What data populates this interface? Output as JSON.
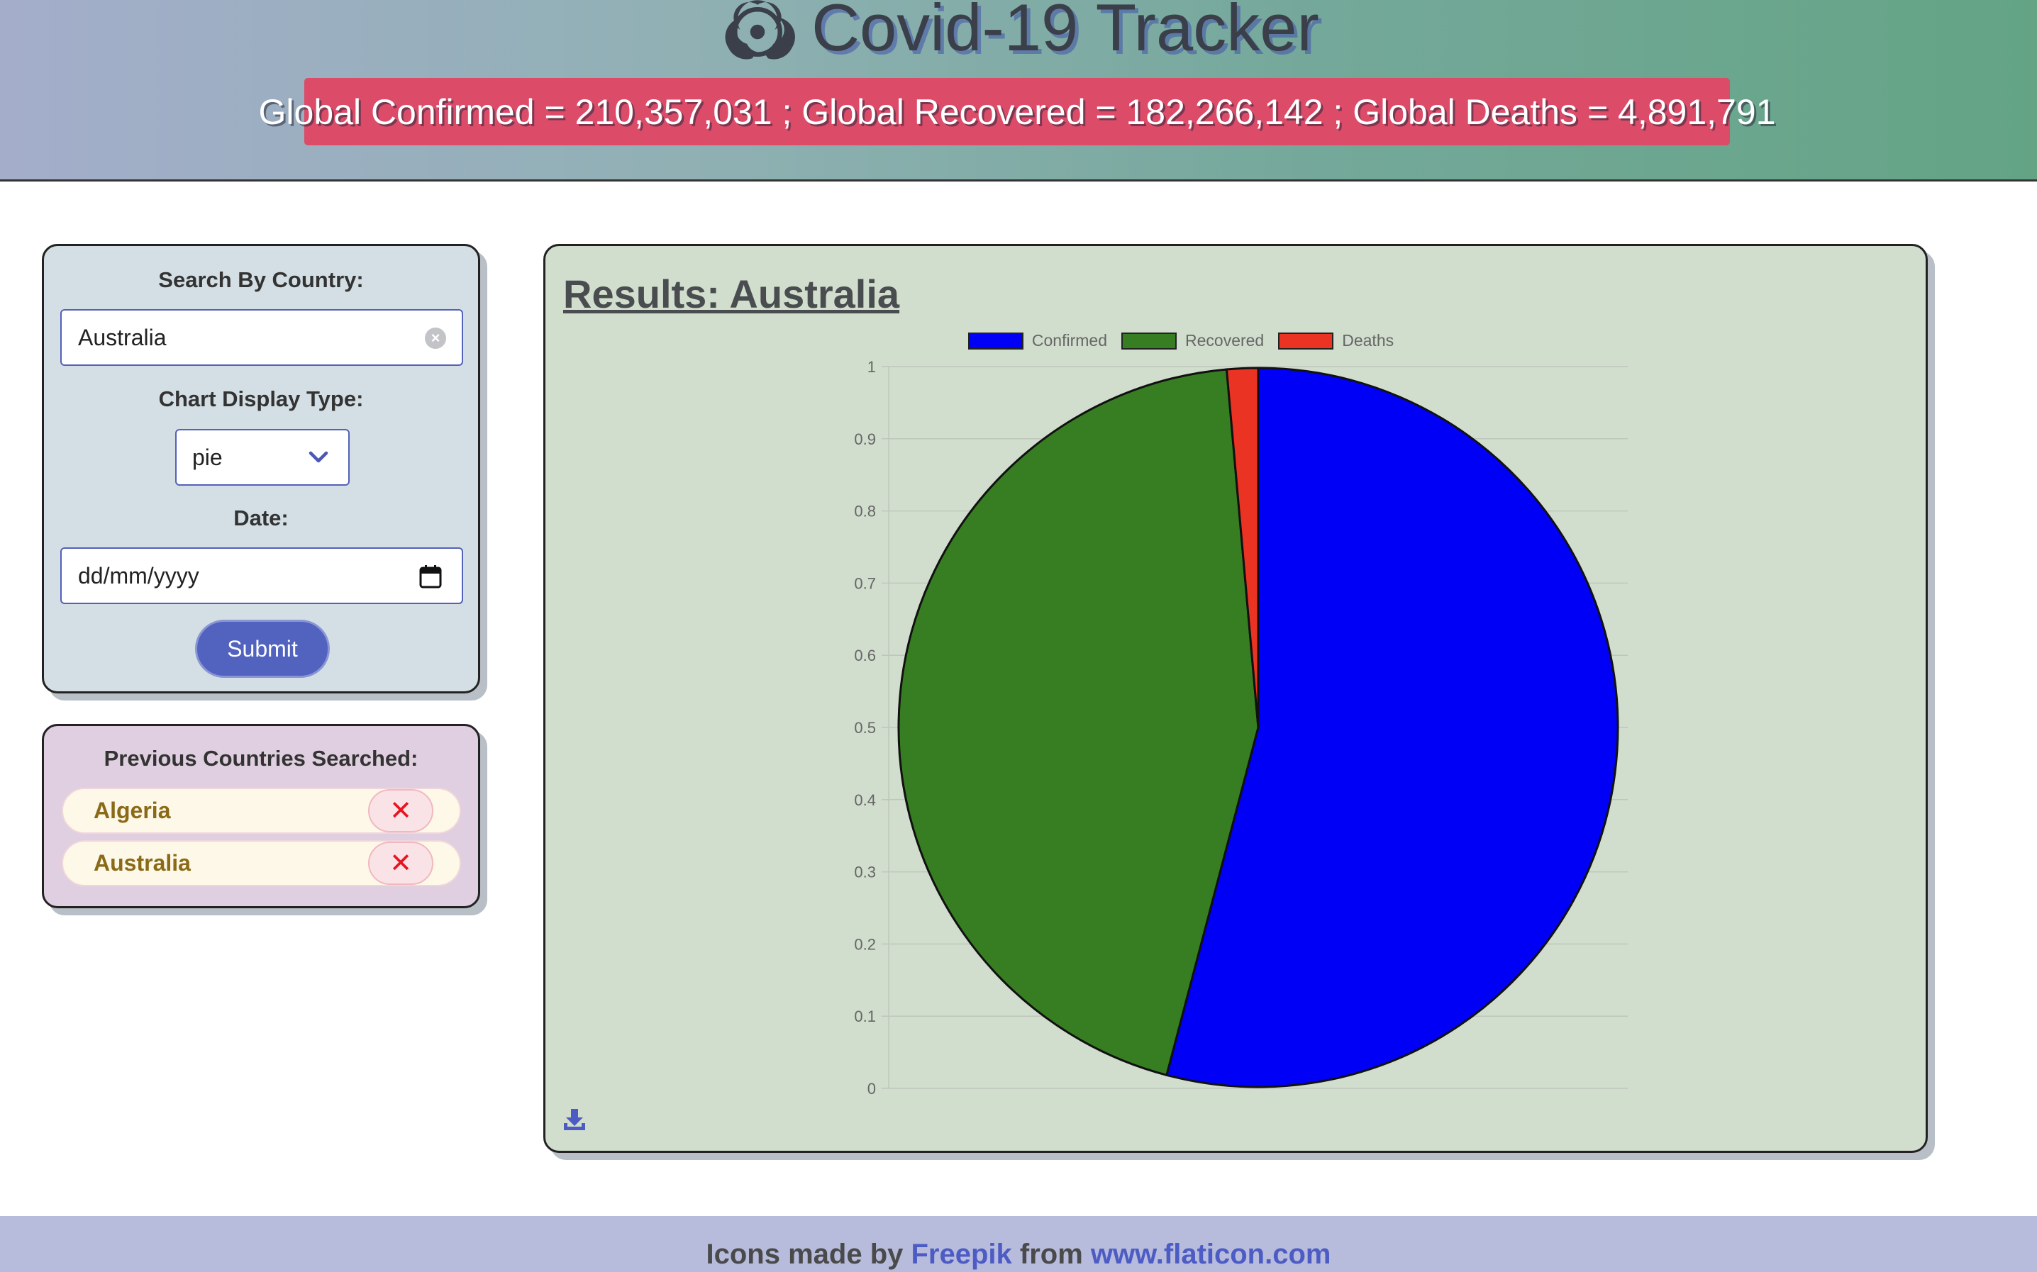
{
  "header": {
    "title": "Covid-19 Tracker",
    "logo_icon": "biohazard-icon",
    "global_stats": "Global Confirmed = 210,357,031 ; Global Recovered = 182,266,142 ; Global Deaths = 4,891,791"
  },
  "search": {
    "country_label": "Search By Country:",
    "country_value": "Australia",
    "chart_type_label": "Chart Display Type:",
    "chart_type_value": "pie",
    "date_label": "Date:",
    "date_placeholder": "dd/mm/yyyy",
    "submit_label": "Submit"
  },
  "previous": {
    "title": "Previous Countries Searched:",
    "items": [
      {
        "name": "Algeria",
        "remove": "✕"
      },
      {
        "name": "Australia",
        "remove": "✕"
      }
    ]
  },
  "results": {
    "title": "Results: Australia"
  },
  "chart_data": {
    "type": "pie",
    "title": "",
    "labels": [
      "Confirmed",
      "Recovered",
      "Deaths"
    ],
    "values": [
      0.541,
      0.445,
      0.014
    ],
    "colors": [
      "#0000f6",
      "#377e22",
      "#eb3324"
    ],
    "y_ticks": [
      "0",
      "0.1",
      "0.2",
      "0.3",
      "0.4",
      "0.5",
      "0.6",
      "0.7",
      "0.8",
      "0.9",
      "1"
    ],
    "ylim": [
      0,
      1
    ],
    "legend_position": "top",
    "grid": true
  },
  "footer": {
    "prefix": "Icons made by ",
    "author": "Freepik",
    "middle": " from ",
    "site": "www.flaticon.com"
  },
  "colors": {
    "global_bar": "#dc4b68",
    "submit": "#5262bf",
    "remove": "#e8141f"
  }
}
